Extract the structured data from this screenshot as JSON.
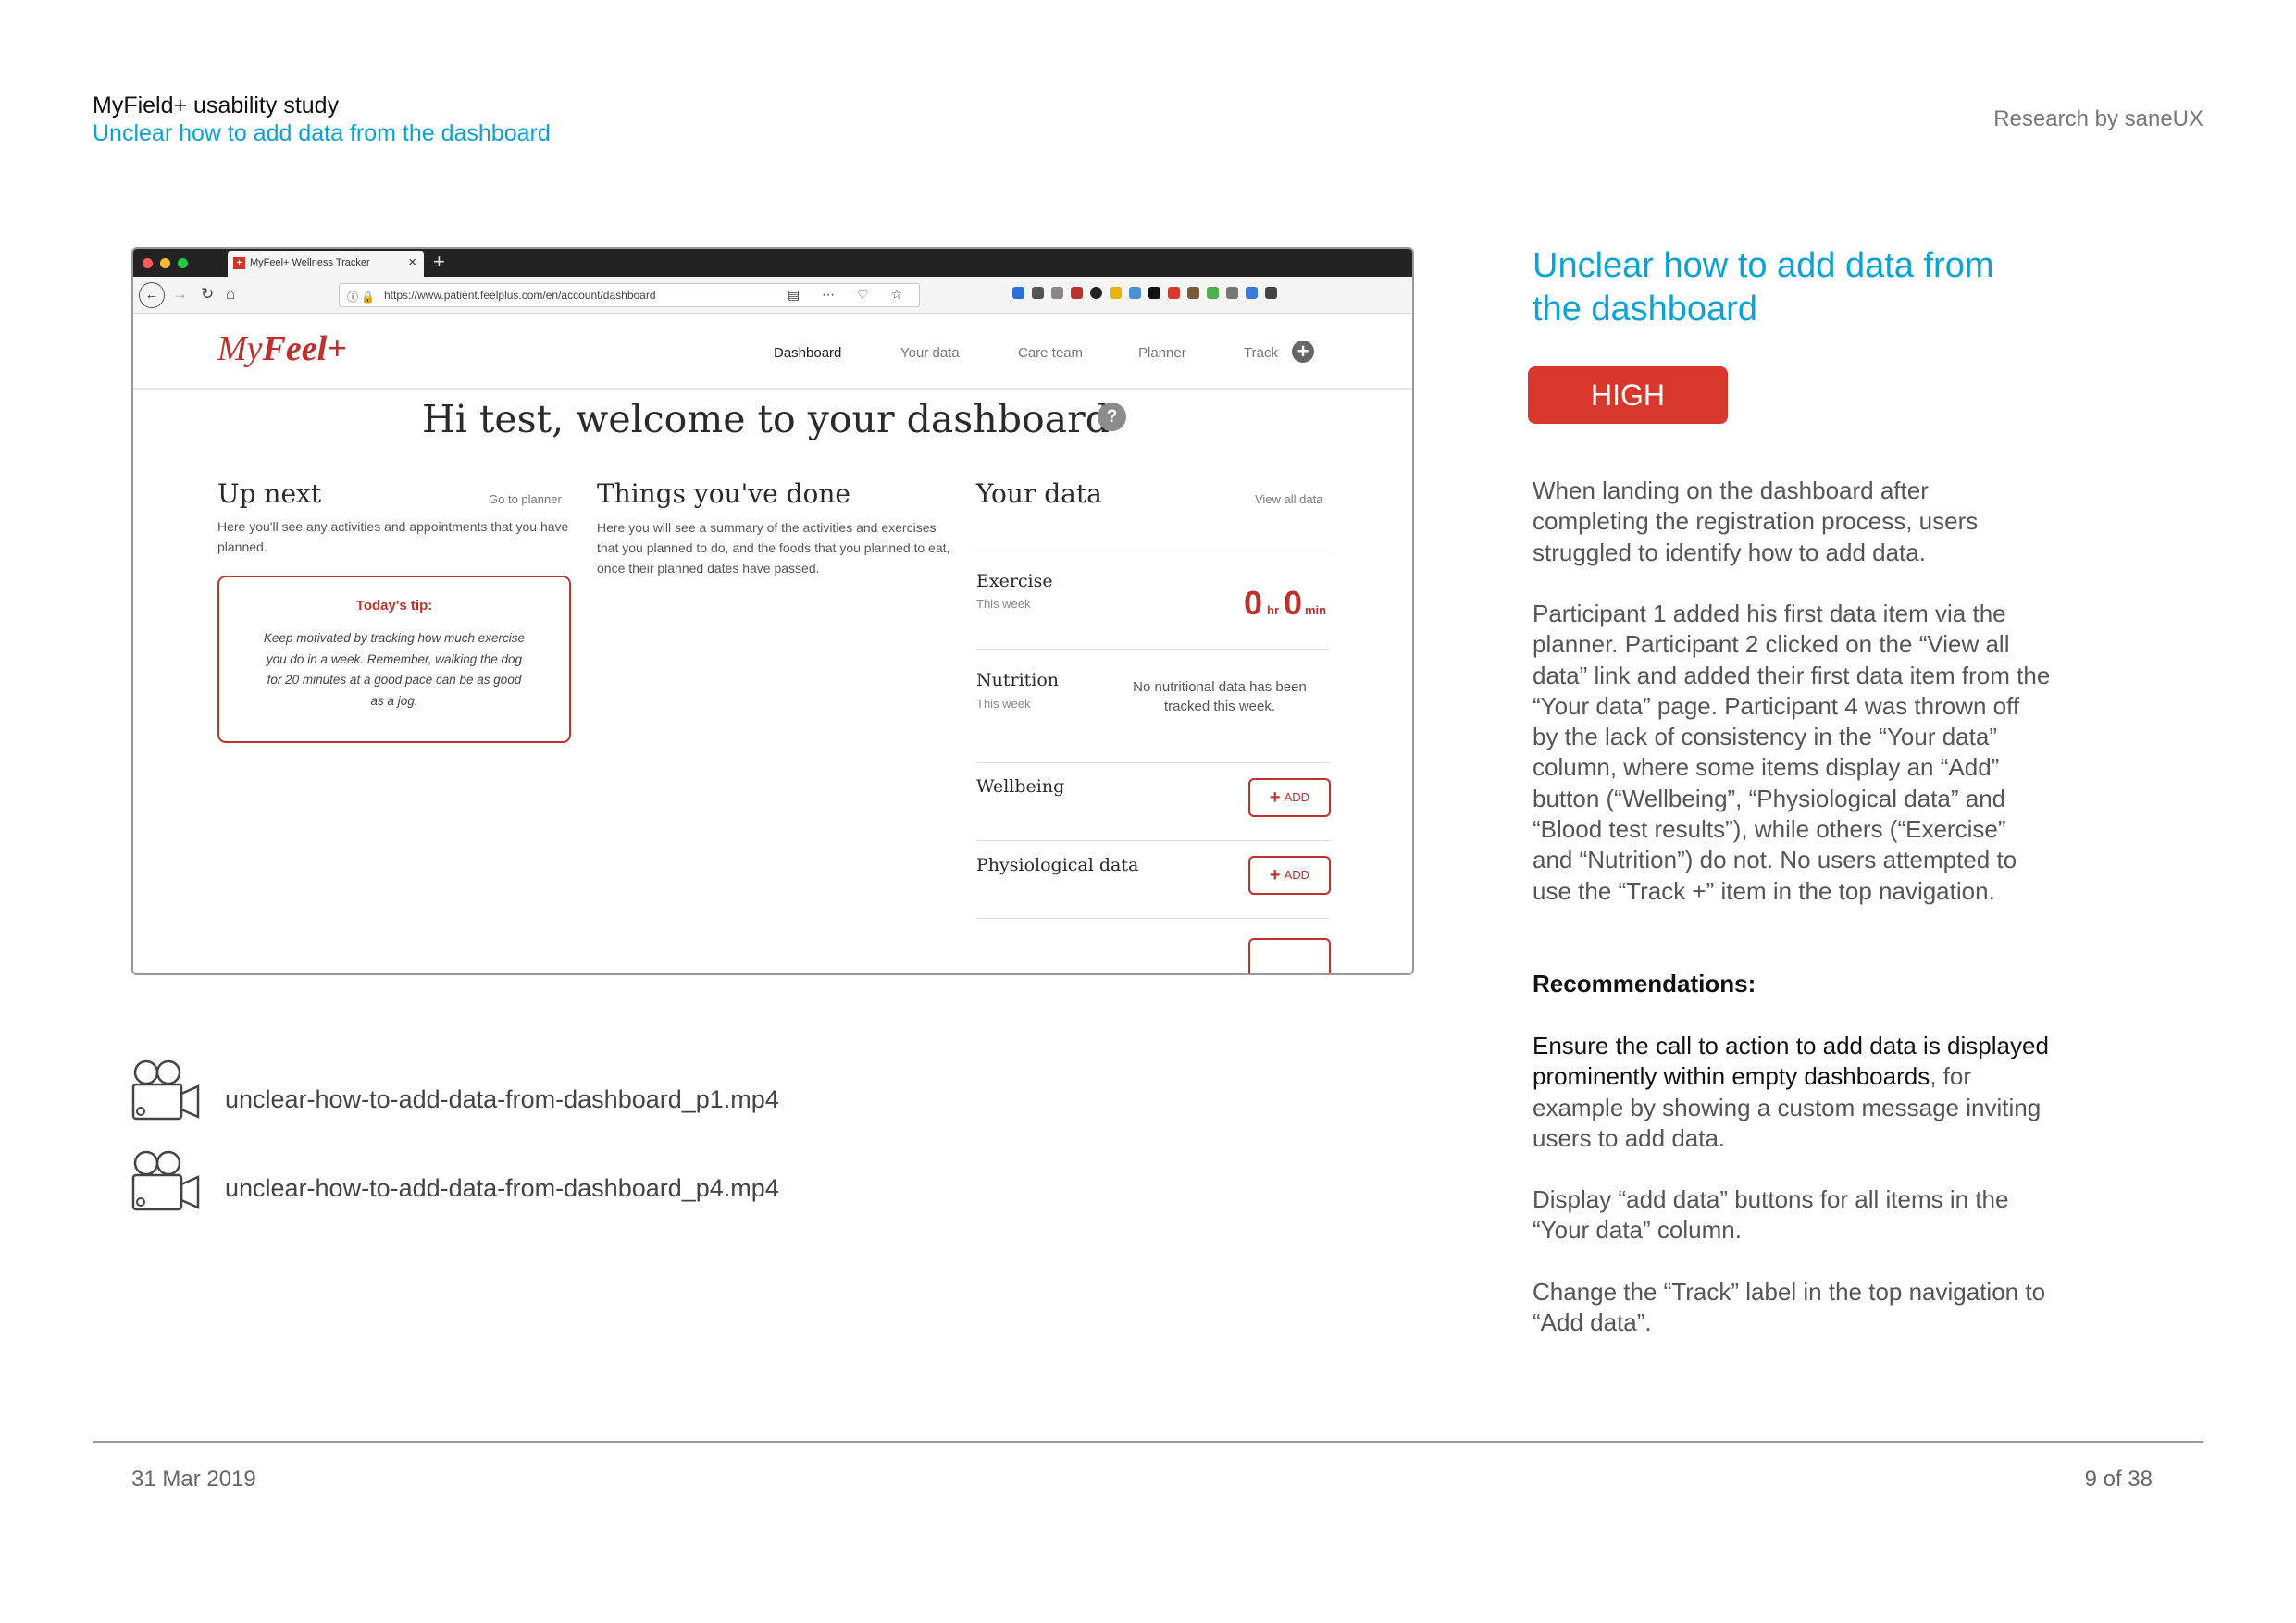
{
  "header": {
    "title": "MyField+ usability study",
    "subtitle": "Unclear how to add data from the dashboard",
    "research_by": "Research by saneUX"
  },
  "browser": {
    "tab_title": "MyFeel+ Wellness Tracker",
    "tab_favicon": "+",
    "url": "https://www.patient.feelplus.com/en/account/dashboard"
  },
  "app": {
    "logo_prefix": "My",
    "logo_brand": "Feel+",
    "nav": [
      "Dashboard",
      "Your data",
      "Care team",
      "Planner",
      "Track"
    ],
    "welcome": "Hi test, welcome to your dashboard",
    "help": "?",
    "up_next": {
      "title": "Up next",
      "link": "Go to planner",
      "text": "Here you'll see any activities and appointments that you have planned.",
      "tip_title": "Today's tip:",
      "tip_body": "Keep motivated by tracking how much exercise you do in a week. Remember, walking the dog for 20 minutes at a good pace can be as good as a jog."
    },
    "done": {
      "title": "Things you've done",
      "text": "Here you will see a summary of the activities and exercises that you planned to do, and the foods that you planned to eat, once their planned dates have passed."
    },
    "your_data": {
      "title": "Your data",
      "link": "View all data",
      "exercise": {
        "label": "Exercise",
        "sub": "This week",
        "hr_value": "0",
        "hr_unit": "hr",
        "min_value": "0",
        "min_unit": "min"
      },
      "nutrition": {
        "label": "Nutrition",
        "sub": "This week",
        "empty": "No nutritional data has been tracked this week."
      },
      "wellbeing": {
        "label": "Wellbeing",
        "button": "ADD"
      },
      "physiological": {
        "label": "Physiological data",
        "button": "ADD"
      }
    }
  },
  "videos": [
    "unclear-how-to-add-data-from-dashboard_p1.mp4",
    "unclear-how-to-add-data-from-dashboard_p4.mp4"
  ],
  "issue": {
    "title": "Unclear how to add data from the dashboard",
    "severity": "HIGH",
    "paragraph1": "When landing on the dashboard after completing the registration process, users struggled to identify how to add data.",
    "paragraph2": "Participant 1 added his first data item via the planner. Participant 2 clicked on the “View all data” link and added their first data item from the “Your data” page. Participant 4 was thrown off by the lack of consistency in the “Your data” column, where some items display an “Add” button (“Wellbeing”, “Physiological data” and “Blood test results”), while others (“Exercise” and “Nutrition”) do not. No users attempted to use the “Track +” item in the top navigation.",
    "recommendations_heading": "Recommendations:",
    "rec1_bold": "Ensure the call to action to add data is displayed prominently within empty dashboards",
    "rec1_rest": ", for example by showing a custom message inviting users to add data.",
    "rec2": "Display “add data” buttons for all items in the “Your data” column.",
    "rec3": "Change the “Track” label in the top navigation to “Add data”."
  },
  "footer": {
    "date": "31 Mar 2019",
    "page": "9 of 38"
  }
}
